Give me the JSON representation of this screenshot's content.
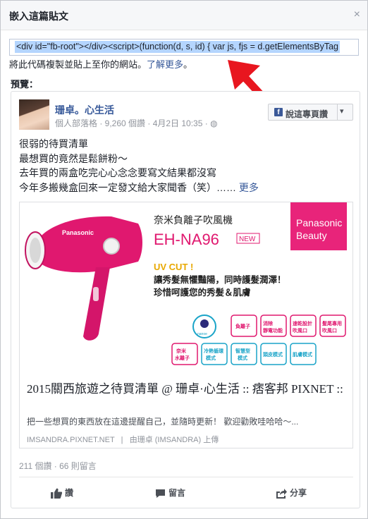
{
  "dialog": {
    "title": "嵌入這篇貼文",
    "close_glyph": "×",
    "embed_code": "<div id=\"fb-root\"></div><script>(function(d, s, id) {  var js, fjs = d.getElementsByTag",
    "hint_text": "將此代碼複製並貼上至你的網站。",
    "learn_more": "了解更多",
    "hint_tail": "。",
    "preview_label": "預覽："
  },
  "post": {
    "author": "珊卓。心生活",
    "meta": "個人部落格 · 9,260 個讚 · 4月2日 10:35 · ",
    "globe_glyph": "◍",
    "follow_label": "說這專頁讚",
    "follow_icon_glyph": "f",
    "follow_caret": "▾",
    "lines": [
      "很弱的待買清單",
      "最想買的竟然是鬆餅粉～",
      "去年買的兩盒吃完心心念念要寫文結果都沒寫"
    ],
    "last_line": "今年多搬幾盒回來一定發文給大家聞香（笑）……",
    "more": "更多",
    "stats": "211 個讚 · 66 則留言",
    "actions": {
      "like": "讚",
      "comment": "留言",
      "share": "分享"
    }
  },
  "link_card": {
    "title": "2015關西旅遊之待買清單 @ 珊卓·心生活 :: 痞客邦 PIXNET ::",
    "description": "把一些想買的東西放在這邊提醒自己，並隨時更新！ 歡迎勸敗哇哈哈～...",
    "domain": "IMSANDRA.PIXNET.NET",
    "domain_sep": "|",
    "uploader": "由珊卓 (IMSANDRA) 上傳"
  },
  "ad_image": {
    "product_cn": "奈米負離子吹風機",
    "model": "EH-NA96",
    "new_badge": "NEW",
    "brand_line1": "Panasonic",
    "brand_line2": "Beauty",
    "uv": "UV CUT !",
    "tag1": "讓秀髮無懼豔陽，同時護髮潤澤！",
    "tag2": "珍惜呵護您的秀髮＆肌膚",
    "dryer_brand": "Panasonic",
    "nanoe": "nanoe",
    "feat_row1": [
      "負離子",
      "消除\n靜電功能",
      "速乾設計\n吹風口",
      "髮尾專用\n吹風口"
    ],
    "feat_row2": [
      "奈米\n水離子",
      "冷熱循環\n模式",
      "智慧型\n模式",
      "頭皮模式",
      "肌膚模式"
    ]
  },
  "colors": {
    "fb_link": "#365899",
    "fb_blue": "#3b5998",
    "arrow_red": "#e8161f",
    "magenta": "#e8247a",
    "teal": "#1aa4c8",
    "code_highlight": "#b4d5fe"
  }
}
